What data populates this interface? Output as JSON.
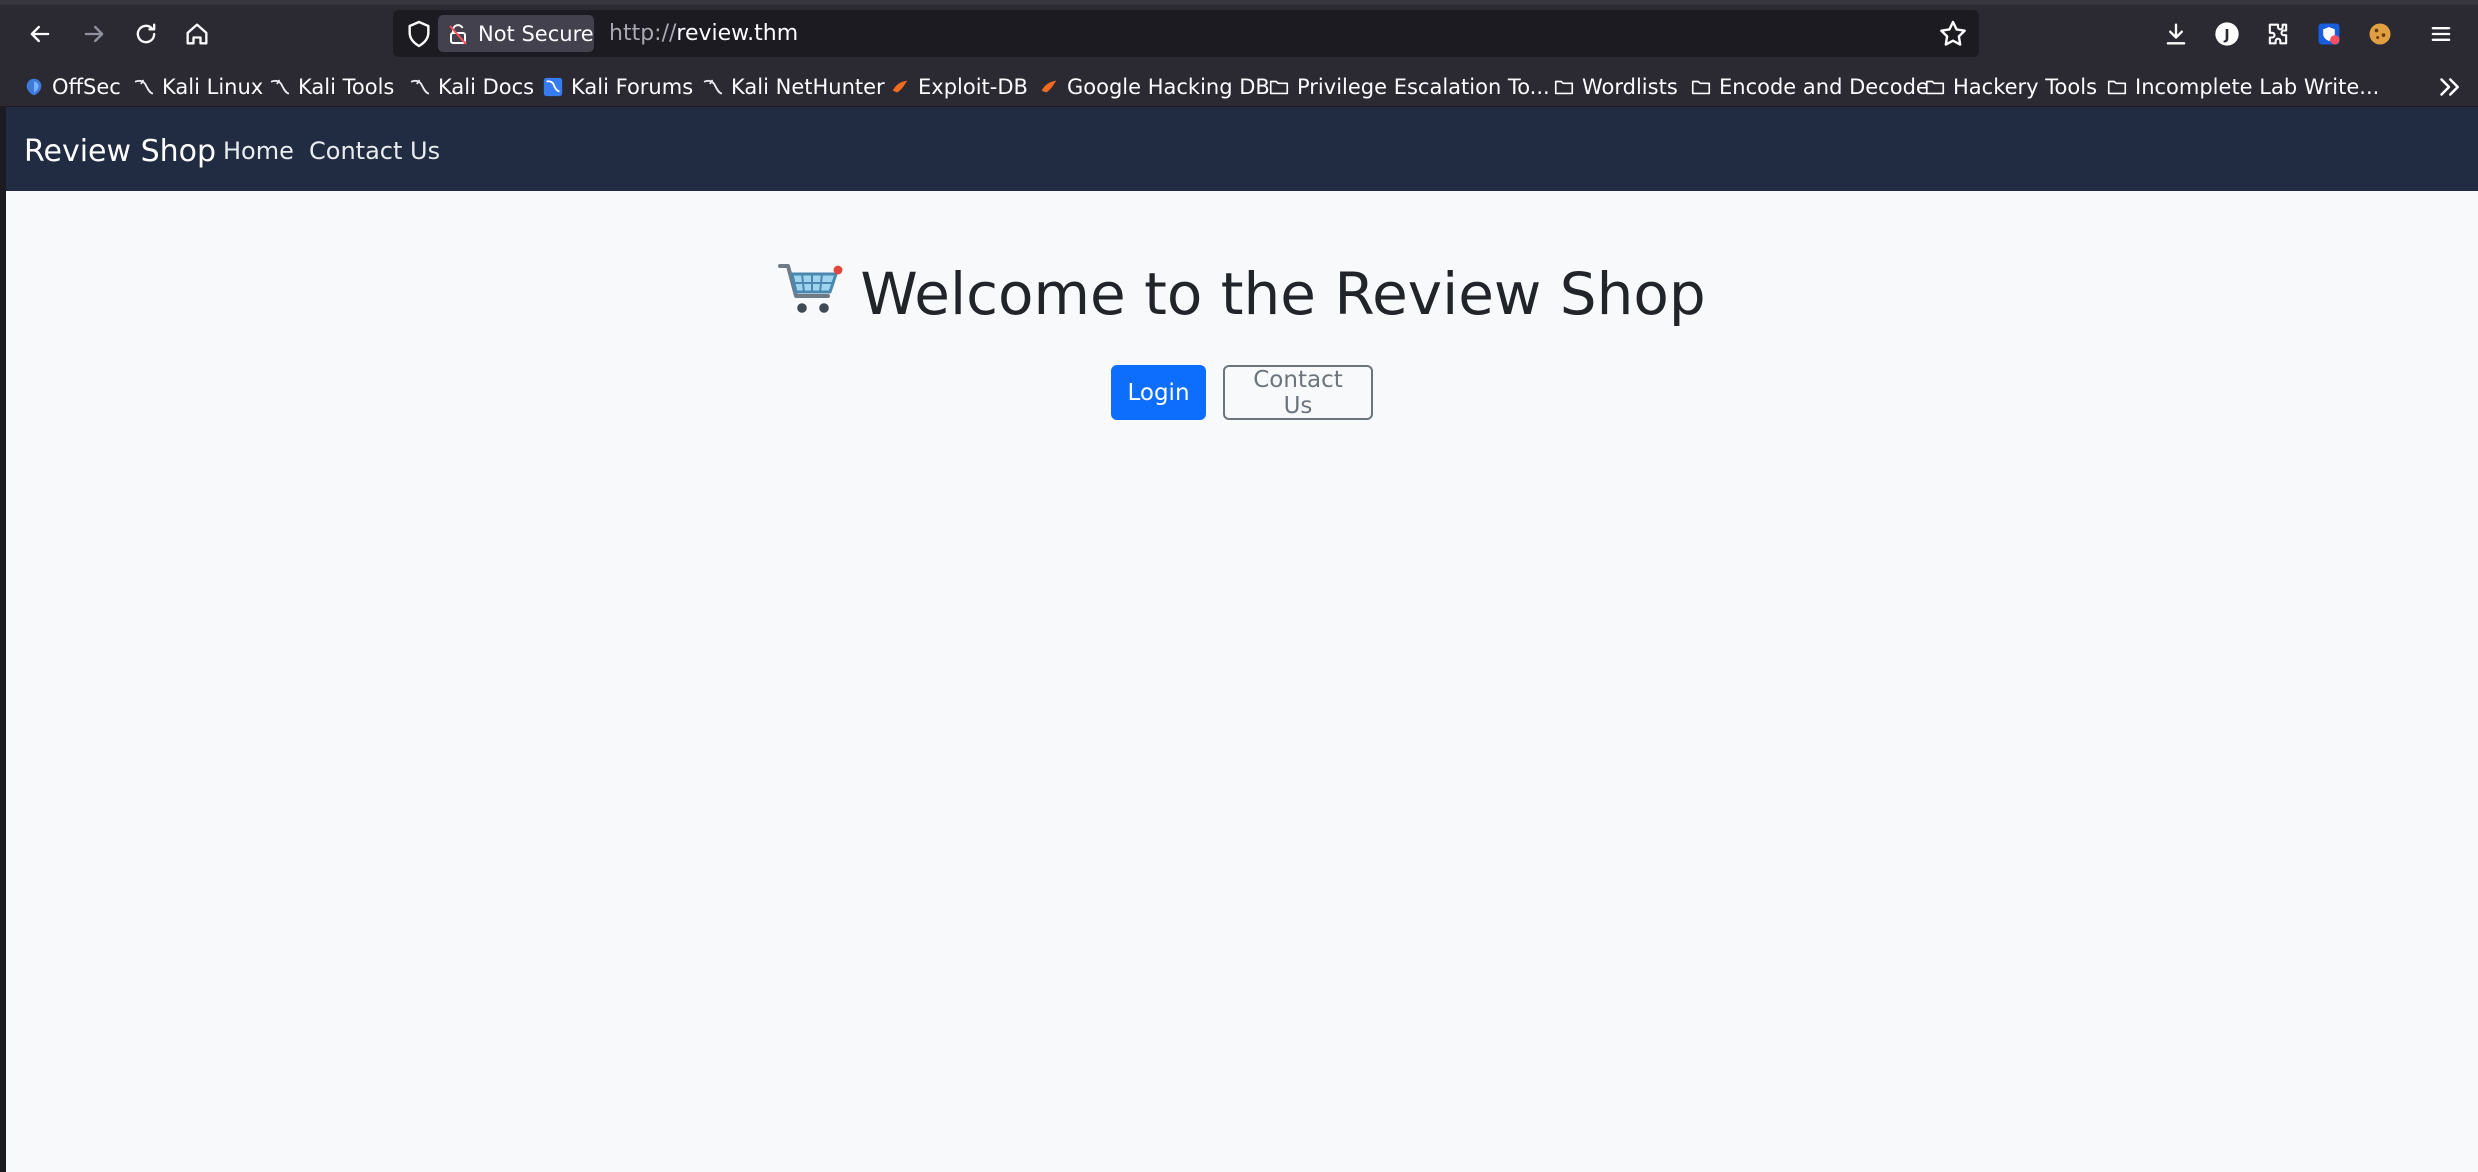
{
  "browser": {
    "url_protocol": "http://",
    "url_host": "review.thm",
    "security_label": "Not Secure"
  },
  "bookmarks": [
    {
      "label": "OffSec",
      "icon": "offsec-icon"
    },
    {
      "label": "Kali Linux",
      "icon": "kali-dragon-icon"
    },
    {
      "label": "Kali Tools",
      "icon": "kali-dragon-icon"
    },
    {
      "label": "Kali Docs",
      "icon": "kali-dragon-icon"
    },
    {
      "label": "Kali Forums",
      "icon": "kali-forums-icon"
    },
    {
      "label": "Kali NetHunter",
      "icon": "kali-dragon-icon"
    },
    {
      "label": "Exploit-DB",
      "icon": "exploit-db-icon"
    },
    {
      "label": "Google Hacking DB",
      "icon": "exploit-db-icon"
    },
    {
      "label": "Privilege Escalation To...",
      "icon": "folder-icon"
    },
    {
      "label": "Wordlists",
      "icon": "folder-icon"
    },
    {
      "label": "Encode and Decode",
      "icon": "folder-icon"
    },
    {
      "label": "Hackery Tools",
      "icon": "folder-icon"
    },
    {
      "label": "Incomplete Lab Write...",
      "icon": "folder-icon"
    }
  ],
  "site": {
    "brand": "Review Shop",
    "nav": [
      "Home",
      "Contact Us"
    ],
    "hero_title": "Welcome to the Review Shop",
    "login_label": "Login",
    "contact_label": "Contact Us"
  },
  "colors": {
    "navbar": "#212b41",
    "primary": "#0d6efd",
    "secondary": "#6c757d",
    "page_bg": "#f8f9fa"
  }
}
